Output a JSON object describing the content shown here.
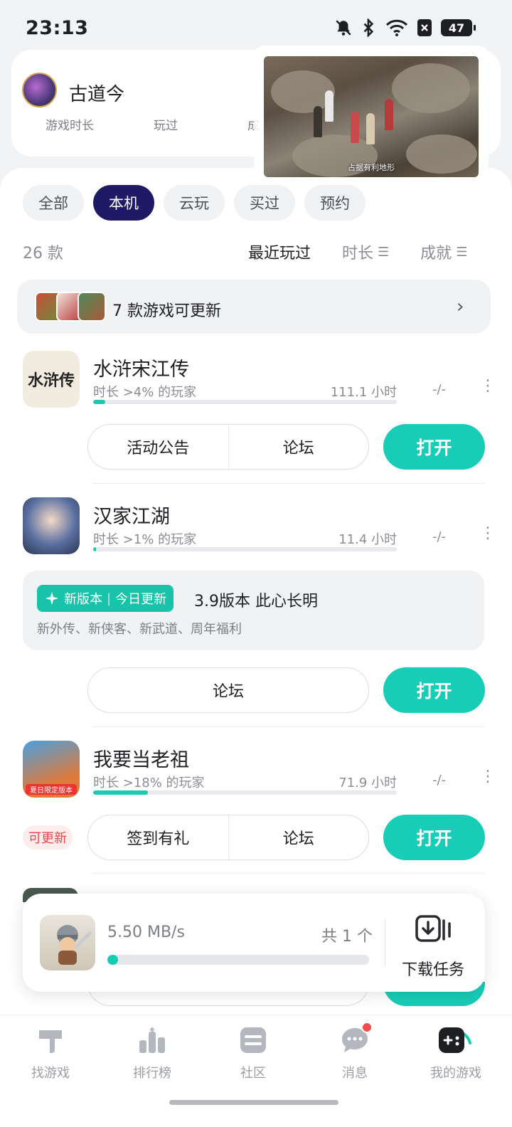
{
  "status": {
    "time": "23:13",
    "battery": "47"
  },
  "profile": {
    "username": "古道今",
    "sub_labels": [
      "游戏时长",
      "玩过",
      "成"
    ]
  },
  "video": {
    "caption": "占据有利地形"
  },
  "filters": {
    "tabs": [
      {
        "label": "全部",
        "active": false
      },
      {
        "label": "本机",
        "active": true
      },
      {
        "label": "云玩",
        "active": false
      },
      {
        "label": "买过",
        "active": false
      },
      {
        "label": "预约",
        "active": false
      }
    ]
  },
  "list_header": {
    "count": "26 款",
    "sort_recent": "最近玩过",
    "sort_duration": "时长",
    "sort_achievement": "成就",
    "sort_glyph": "☰"
  },
  "update_banner": {
    "text": "7 款游戏可更新",
    "chevron": "›"
  },
  "games": [
    {
      "title": "水浒宋江传",
      "sub": "时长 >4% 的玩家",
      "hours": "111.1 小时",
      "achievement": "-/-",
      "progress": 0.04,
      "actions": [
        "活动公告",
        "论坛"
      ],
      "open_label": "打开",
      "icon_text": "水浒传"
    },
    {
      "title": "汉家江湖",
      "sub": "时长 >1% 的玩家",
      "hours": "11.4 小时",
      "achievement": "-/-",
      "progress": 0.01,
      "actions": [
        "论坛"
      ],
      "open_label": "打开",
      "news": {
        "badge_new": "新版本",
        "badge_today": "今日更新",
        "title": "3.9版本 此心长明",
        "desc": "新外传、新侠客、新武道、周年福利"
      }
    },
    {
      "title": "我要当老祖",
      "sub": "时长 >18% 的玩家",
      "hours": "71.9 小时",
      "achievement": "-/-",
      "progress": 0.18,
      "actions": [
        "签到有礼",
        "论坛"
      ],
      "open_label": "打开",
      "tag": "可更新",
      "icon_caption": "夏日限定版本"
    }
  ],
  "download": {
    "speed": "5.50 MB/s",
    "total": "共 1 个",
    "progress": 0.04,
    "tasks_label": "下载任务"
  },
  "nav": {
    "items": [
      {
        "label": "找游戏",
        "icon": "find-games-icon"
      },
      {
        "label": "排行榜",
        "icon": "ranking-icon"
      },
      {
        "label": "社区",
        "icon": "community-icon"
      },
      {
        "label": "消息",
        "icon": "message-icon"
      },
      {
        "label": "我的游戏",
        "icon": "my-games-icon"
      }
    ]
  },
  "colors": {
    "accent": "#17cdb7",
    "active_tab": "#1f1a66",
    "update_tag": "#e5484d"
  }
}
